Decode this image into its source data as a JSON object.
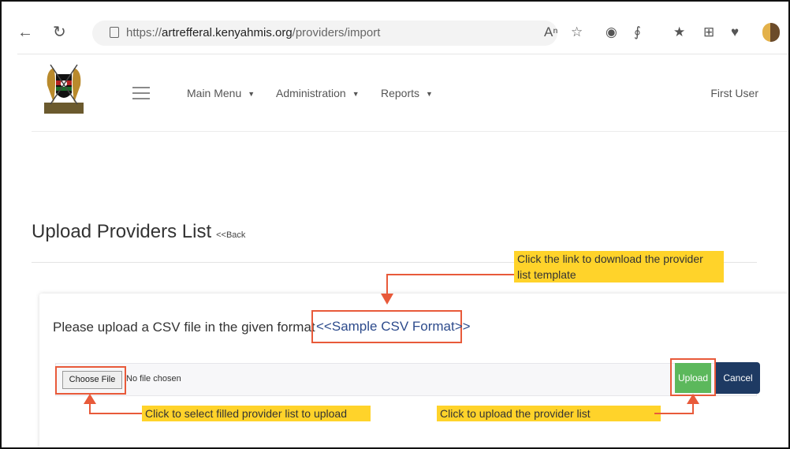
{
  "browser": {
    "url_prefix": "https://",
    "url_domain": "artrefferal.kenyahmis.org",
    "url_path": "/providers/import",
    "icons": [
      "back-icon",
      "refresh-icon",
      "lock-icon",
      "read-aloud-icon",
      "favorite-add-icon",
      "extension-icon",
      "copilot-icon",
      "favorites-icon",
      "collections-icon",
      "heart-icon",
      "profile-avatar"
    ]
  },
  "nav": {
    "main_menu": "Main Menu",
    "administration": "Administration",
    "reports": "Reports",
    "user": "First User"
  },
  "page": {
    "title": "Upload Providers List",
    "back": "<<Back",
    "instruction": "Please upload a CSV file in the given format",
    "sample_link": "<<Sample CSV Format>>"
  },
  "file_input": {
    "choose_label": "Choose File",
    "status": "No file chosen"
  },
  "buttons": {
    "upload": "Upload",
    "cancel": "Cancel"
  },
  "annotations": {
    "download_line1": "Click the link to download the provider",
    "download_line2": "list template",
    "select_file": "Click to select filled provider list to upload",
    "upload": "Click to upload the provider list"
  },
  "colors": {
    "highlight": "#ffd32a",
    "annotation_border": "#e85a3a",
    "upload_button": "#5cb85c",
    "cancel_button": "#1e3a63",
    "link": "#2d4b8c"
  }
}
